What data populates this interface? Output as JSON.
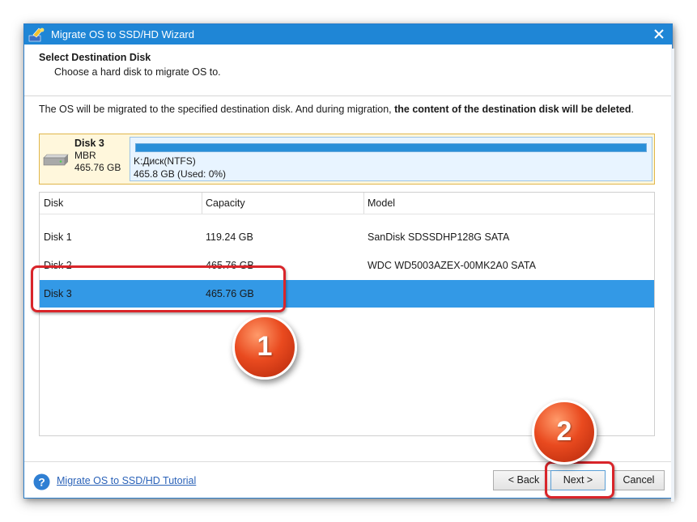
{
  "window": {
    "title": "Migrate OS to SSD/HD Wizard"
  },
  "header": {
    "step_title": "Select Destination Disk",
    "step_subtitle": "Choose a hard disk to migrate OS to."
  },
  "notice": {
    "text_normal": "The OS will be migrated to the specified destination disk. And during migration, ",
    "text_bold": "the content of the destination disk will be deleted",
    "text_end": "."
  },
  "selected_disk_card": {
    "name": "Disk 3",
    "partition_style": "MBR",
    "size": "465.76 GB",
    "partition_label": "K:Диск(NTFS)",
    "partition_usage": "465.8 GB (Used: 0%)",
    "used_fraction": 0.0
  },
  "disk_table": {
    "columns": [
      "Disk",
      "Capacity",
      "Model"
    ],
    "rows": [
      {
        "disk": "Disk 1",
        "capacity": "119.24 GB",
        "model": "SanDisk SDSSDHP128G SATA",
        "selected": false
      },
      {
        "disk": "Disk 2",
        "capacity": "465.76 GB",
        "model": "WDC WD5003AZEX-00MK2A0 SATA",
        "selected": false
      },
      {
        "disk": "Disk 3",
        "capacity": "465.76 GB",
        "model": "",
        "selected": true
      }
    ]
  },
  "footer": {
    "tutorial_link": "Migrate OS to SSD/HD Tutorial",
    "back_label": "< Back",
    "next_label": "Next >",
    "cancel_label": "Cancel"
  },
  "annotations": {
    "badge_1": "1",
    "badge_2": "2"
  },
  "colors": {
    "titlebar": "#1f86d6",
    "selected_row": "#3399e6",
    "highlight": "#d9252a",
    "badge": "#e94a1f"
  }
}
